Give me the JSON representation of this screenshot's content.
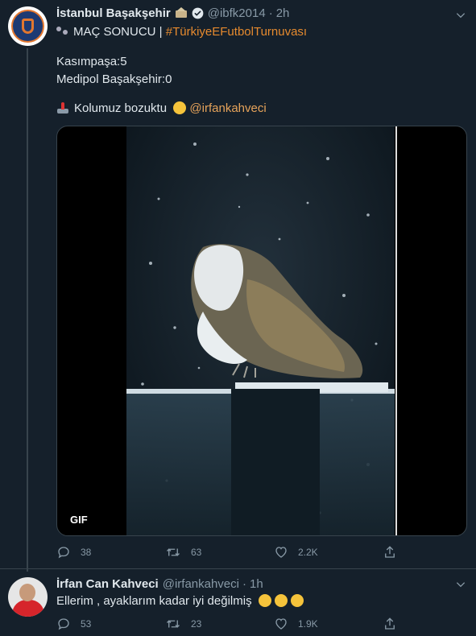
{
  "tweet1": {
    "name": "İstanbul Başakşehir",
    "handle": "@ibfk2014",
    "separator": "·",
    "time": "2h",
    "line1_prefix": "MAÇ SONUCU |",
    "line1_hashtag": "#TürkiyeEFutbolTurnuvası",
    "line2": "Kasımpaşa:5",
    "line3": "Medipol Başakşehir:0",
    "line4_text": "Kolumuz bozuktu",
    "line4_mention": "@irfankahveci",
    "gif_badge": "GIF",
    "reply_count": "38",
    "retweet_count": "63",
    "like_count": "2.2K"
  },
  "tweet2": {
    "name": "İrfan Can Kahveci",
    "handle": "@irfankahveci",
    "separator": "·",
    "time": "1h",
    "text": "Ellerim , ayaklarım kadar iyi değilmiş",
    "reply_count": "53",
    "retweet_count": "23",
    "like_count": "1.9K"
  },
  "colors": {
    "background": "#15202b",
    "secondary_text": "#8899a6",
    "hashtag": "#e68a2e",
    "mention": "#e6a35a"
  }
}
